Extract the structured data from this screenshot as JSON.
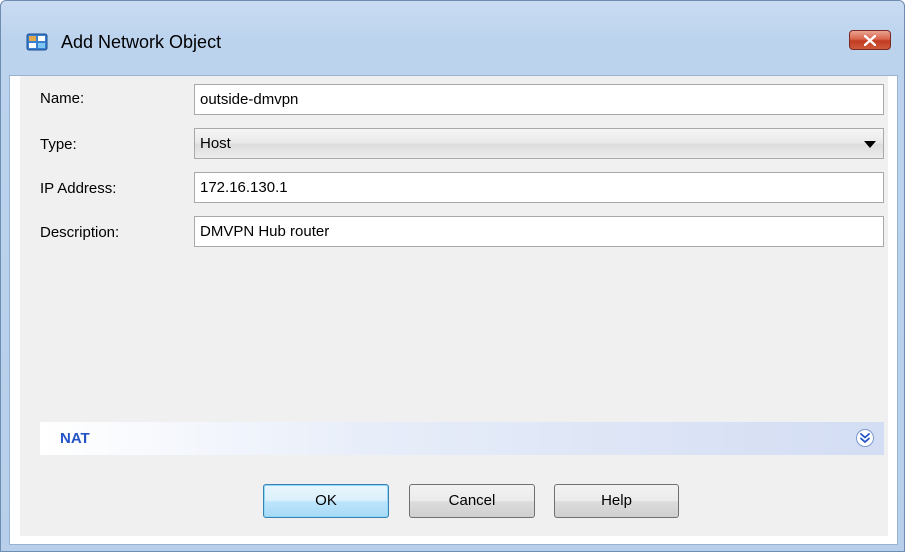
{
  "window": {
    "title": "Add Network Object"
  },
  "form": {
    "name_label": "Name:",
    "name_value": "outside-dmvpn",
    "type_label": "Type:",
    "type_value": "Host",
    "ip_label": "IP Address:",
    "ip_value": "172.16.130.1",
    "description_label": "Description:",
    "description_value": "DMVPN Hub router"
  },
  "nat": {
    "label": "NAT"
  },
  "buttons": {
    "ok": "OK",
    "cancel": "Cancel",
    "help": "Help"
  },
  "colors": {
    "nat_text": "#2354c6",
    "close_button": "#c23b22",
    "title_bar": "#c9dcf2"
  },
  "icons": {
    "app": "network-object-icon",
    "close": "close-icon",
    "dropdown": "chevron-down-icon",
    "expand": "double-chevron-down-icon"
  }
}
